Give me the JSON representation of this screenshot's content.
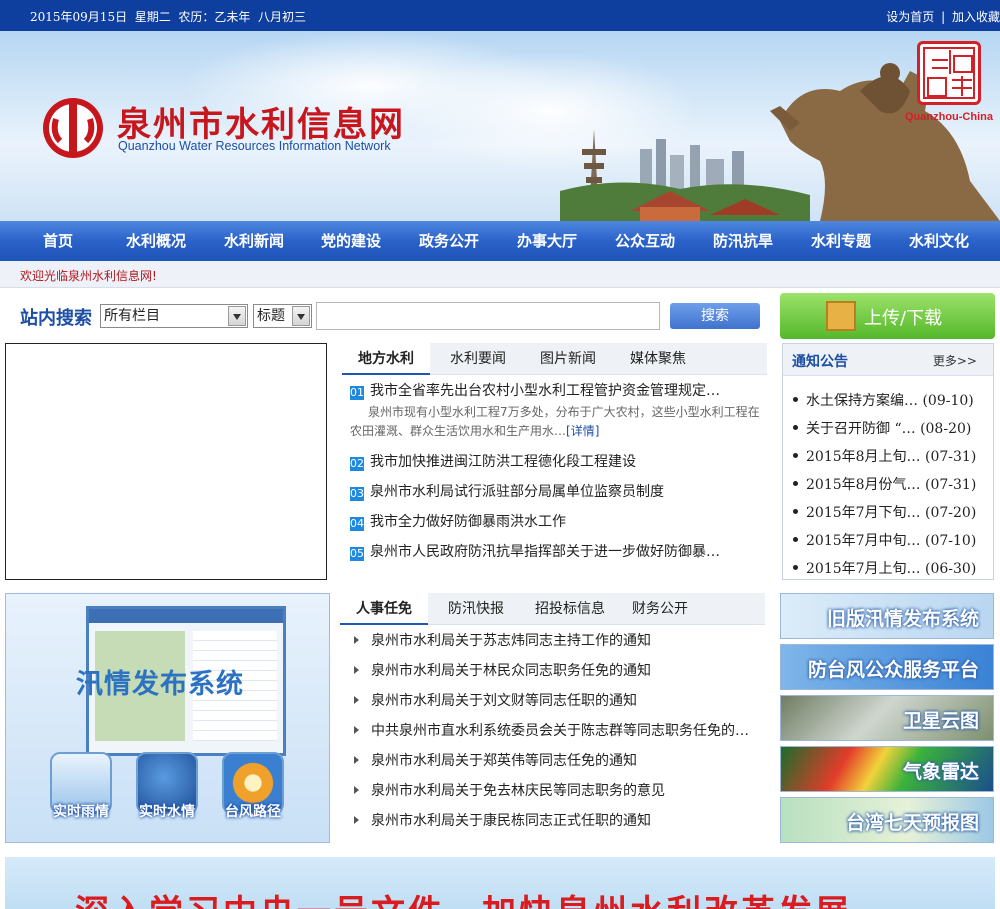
{
  "topbar": {
    "date": "2015年09月15日  星期二  农历：乙未年  八月初三",
    "homepage_link": "设为首页",
    "favorite_link": "加入收藏",
    "separator": "|"
  },
  "banner": {
    "title": "泉州市水利信息网",
    "subtitle": "Quanzhou Water Resources Information Network",
    "seal_caption": "Quanzhou-China"
  },
  "nav": {
    "items": [
      "首页",
      "水利概况",
      "水利新闻",
      "党的建设",
      "政务公开",
      "办事大厅",
      "公众互动",
      "防汛抗旱",
      "水利专题",
      "水利文化"
    ]
  },
  "welcome": "欢迎光临泉州水利信息网!",
  "search": {
    "label": "站内搜索",
    "scope": "所有栏目",
    "field": "标题",
    "query": "",
    "button": "搜索"
  },
  "upload": {
    "label": "上传/下载"
  },
  "news_tabs": {
    "tabs": [
      "地方水利",
      "水利要闻",
      "图片新闻",
      "媒体聚焦"
    ],
    "items": [
      {
        "num": "01",
        "title": "我市全省率先出台农村小型水利工程管护资金管理规定…"
      },
      {
        "num": "02",
        "title": "我市加快推进闽江防洪工程德化段工程建设"
      },
      {
        "num": "03",
        "title": "泉州市水利局试行派驻部分局属单位监察员制度"
      },
      {
        "num": "04",
        "title": "我市全力做好防御暴雨洪水工作"
      },
      {
        "num": "05",
        "title": "泉州市人民政府防汛抗旱指挥部关于进一步做好防御暴…"
      }
    ],
    "summary": "泉州市现有小型水利工程7万多处，分布于广大农村，这些小型水利工程在农田灌溉、群众生活饮用水和生产用水…",
    "summary_more": "[详情]"
  },
  "notice": {
    "title": "通知公告",
    "more": "更多>>",
    "items": [
      {
        "title": "水土保持方案编…",
        "date": "(09-10)"
      },
      {
        "title": "关于召开防御 “…",
        "date": "(08-20)"
      },
      {
        "title": "2015年8月上旬…",
        "date": "(07-31)"
      },
      {
        "title": "2015年8月份气…",
        "date": "(07-31)"
      },
      {
        "title": "2015年7月下旬…",
        "date": "(07-20)"
      },
      {
        "title": "2015年7月中旬…",
        "date": "(07-10)"
      },
      {
        "title": "2015年7月上旬…",
        "date": "(06-30)"
      }
    ]
  },
  "flood_system": {
    "title": "汛情发布系统",
    "buttons": [
      "实时雨情",
      "实时水情",
      "台风路径"
    ]
  },
  "hr_tabs": {
    "tabs": [
      "人事任免",
      "防汛快报",
      "招投标信息",
      "财务公开"
    ],
    "items": [
      "泉州市水利局关于苏志炜同志主持工作的通知",
      "泉州市水利局关于林民众同志职务任免的通知",
      "泉州市水利局关于刘文财等同志任职的通知",
      "中共泉州市直水利系统委员会关于陈志群等同志职务任免的…",
      "泉州市水利局关于郑英伟等同志任免的通知",
      "泉州市水利局关于免去林庆民等同志职务的意见",
      "泉州市水利局关于康民栋同志正式任职的通知"
    ]
  },
  "right_banners": [
    "旧版汛情发布系统",
    "防台风公众服务平台",
    "卫星云图",
    "气象雷达",
    "台湾七天预报图"
  ],
  "bottom_banner": "深入学习中央一号文件，加快泉州水利改革发展",
  "colors": {
    "nav": "#2a62c9",
    "topbar": "#0f3f9e",
    "title_red": "#c8161d",
    "accent_blue": "#1c4ea5"
  }
}
